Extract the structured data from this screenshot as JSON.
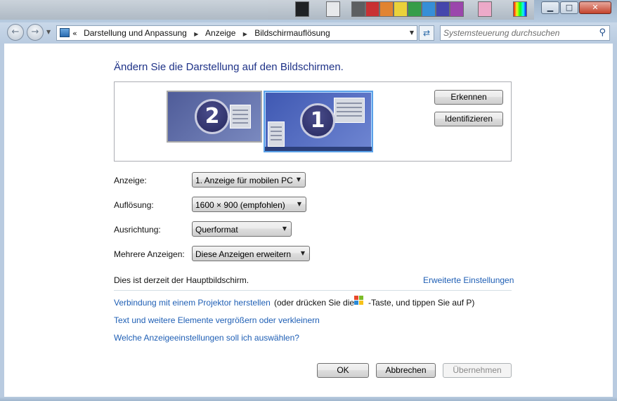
{
  "window": {
    "minimize": "▁",
    "maximize": "□",
    "close": "✕"
  },
  "nav": {
    "back_icon": "←",
    "forward_icon": "→",
    "breadcrumb_overflow": "«",
    "breadcrumbs": [
      "Darstellung und Anpassung",
      "Anzeige",
      "Bildschirmauflösung"
    ],
    "search_placeholder": "Systemsteuerung durchsuchen"
  },
  "main": {
    "heading": "Ändern Sie die Darstellung auf den Bildschirmen.",
    "monitors": {
      "secondary_number": "2",
      "primary_number": "1"
    },
    "detect_button": "Erkennen",
    "identify_button": "Identifizieren",
    "fields": {
      "display_label": "Anzeige:",
      "display_value": "1. Anzeige für mobilen PC",
      "resolution_label": "Auflösung:",
      "resolution_value": "1600 × 900 (empfohlen)",
      "orientation_label": "Ausrichtung:",
      "orientation_value": "Querformat",
      "multiple_label": "Mehrere Anzeigen:",
      "multiple_value": "Diese Anzeigen erweitern"
    },
    "primary_status": "Dies ist derzeit der Hauptbildschirm.",
    "advanced_link": "Erweiterte Einstellungen",
    "projector_link": "Verbindung mit einem Projektor herstellen",
    "projector_hint_pre": "(oder drücken Sie die",
    "projector_hint_post": "-Taste, und tippen Sie auf P)",
    "textsize_link": "Text und weitere Elemente vergrößern oder verkleinern",
    "help_link": "Welche Anzeigeeinstellungen soll ich auswählen?"
  },
  "footer": {
    "ok": "OK",
    "cancel": "Abbrechen",
    "apply": "Übernehmen"
  }
}
